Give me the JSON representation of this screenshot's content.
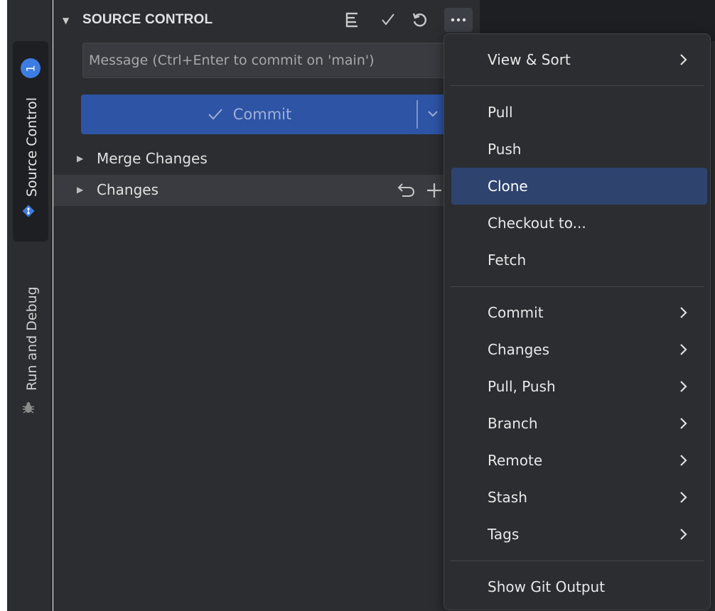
{
  "activity_bar": {
    "source_control_label": "Source Control",
    "source_control_badge": "1",
    "run_debug_label": "Run and Debug"
  },
  "panel": {
    "title": "SOURCE CONTROL",
    "message_placeholder": "Message (Ctrl+Enter to commit on 'main')",
    "commit_label": "Commit",
    "groups": [
      {
        "label": "Merge Changes"
      },
      {
        "label": "Changes"
      }
    ]
  },
  "menu": {
    "items": [
      {
        "label": "View & Sort",
        "submenu": true
      },
      {
        "label": "Pull"
      },
      {
        "label": "Push"
      },
      {
        "label": "Clone",
        "highlighted": true
      },
      {
        "label": "Checkout to..."
      },
      {
        "label": "Fetch"
      },
      {
        "label": "Commit",
        "submenu": true
      },
      {
        "label": "Changes",
        "submenu": true
      },
      {
        "label": "Pull, Push",
        "submenu": true
      },
      {
        "label": "Branch",
        "submenu": true
      },
      {
        "label": "Remote",
        "submenu": true
      },
      {
        "label": "Stash",
        "submenu": true
      },
      {
        "label": "Tags",
        "submenu": true
      },
      {
        "label": "Show Git Output"
      }
    ]
  },
  "colors": {
    "accent": "#2d54a5",
    "badge": "#3d7ce0",
    "menu_highlight": "#2e436e"
  }
}
